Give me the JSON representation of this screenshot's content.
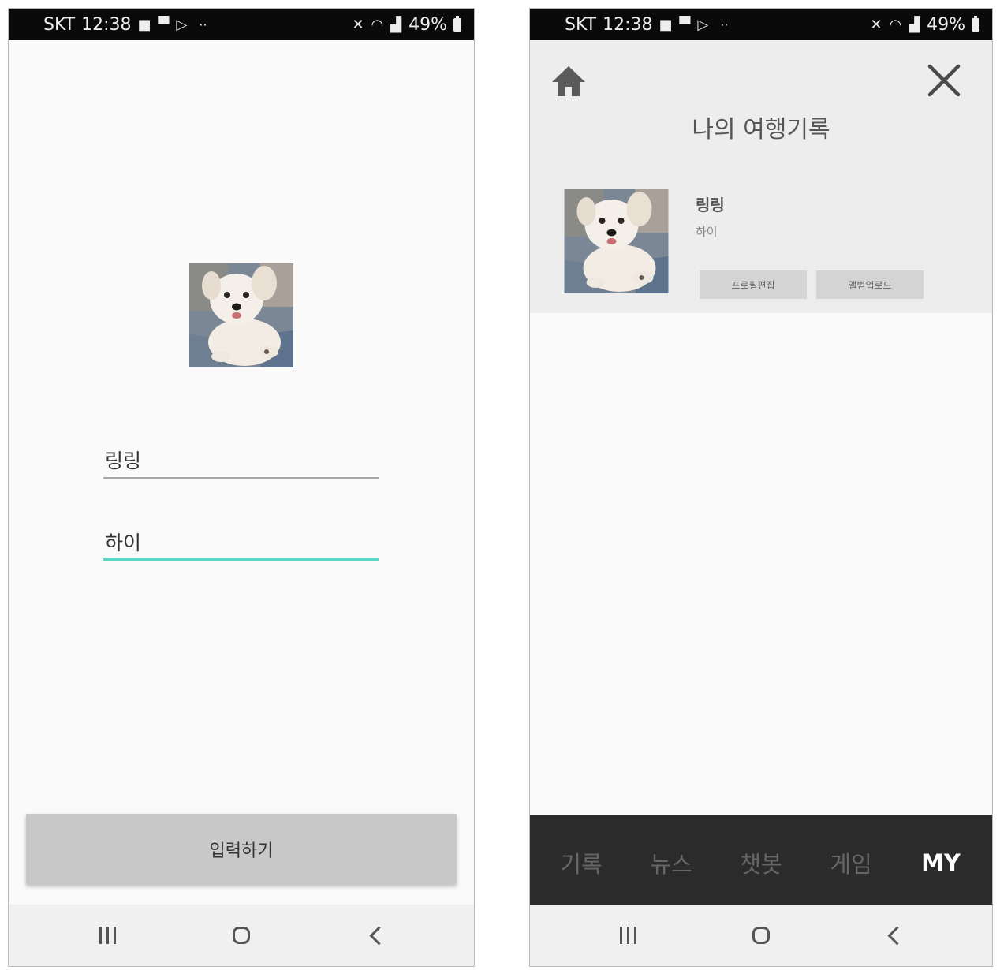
{
  "status_bar": {
    "carrier": "SKT",
    "time": "12:38",
    "battery": "49%"
  },
  "left_screen": {
    "name_field": {
      "value": "링링"
    },
    "intro_field": {
      "value": "하이"
    },
    "submit_label": "입력하기",
    "accent_color": "#5fd3c4"
  },
  "right_screen": {
    "title": "나의 여행기록",
    "profile": {
      "name": "링링",
      "intro": "하이"
    },
    "buttons": {
      "edit_profile": "프로필편집",
      "upload_album": "앨범업로드"
    },
    "tabs": [
      {
        "label": "기록"
      },
      {
        "label": "뉴스"
      },
      {
        "label": "챗봇"
      },
      {
        "label": "게임"
      },
      {
        "label": "MY",
        "active": true
      }
    ]
  },
  "icons": [
    "home-icon",
    "close-icon",
    "recent-apps-icon",
    "home-button-icon",
    "back-icon",
    "camera-icon",
    "message-icon",
    "play-icon",
    "mute-icon",
    "wifi-icon",
    "signal-icon",
    "battery-icon"
  ]
}
